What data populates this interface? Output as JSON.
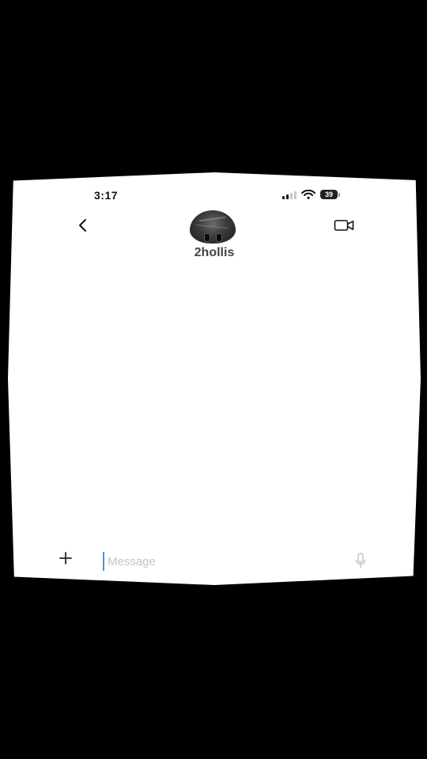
{
  "status_bar": {
    "time": "3:17",
    "battery_level": "39"
  },
  "header": {
    "back_icon": "chevron-left-icon",
    "username": "2hollis",
    "video_call_icon": "video-camera-icon"
  },
  "composer": {
    "add_icon": "plus-icon",
    "message_placeholder": "Message",
    "message_value": "",
    "mic_icon": "microphone-icon"
  },
  "colors": {
    "background": "#000000",
    "screen": "#ffffff",
    "cursor_accent": "#4a90e2",
    "placeholder": "#c4c4c4"
  }
}
